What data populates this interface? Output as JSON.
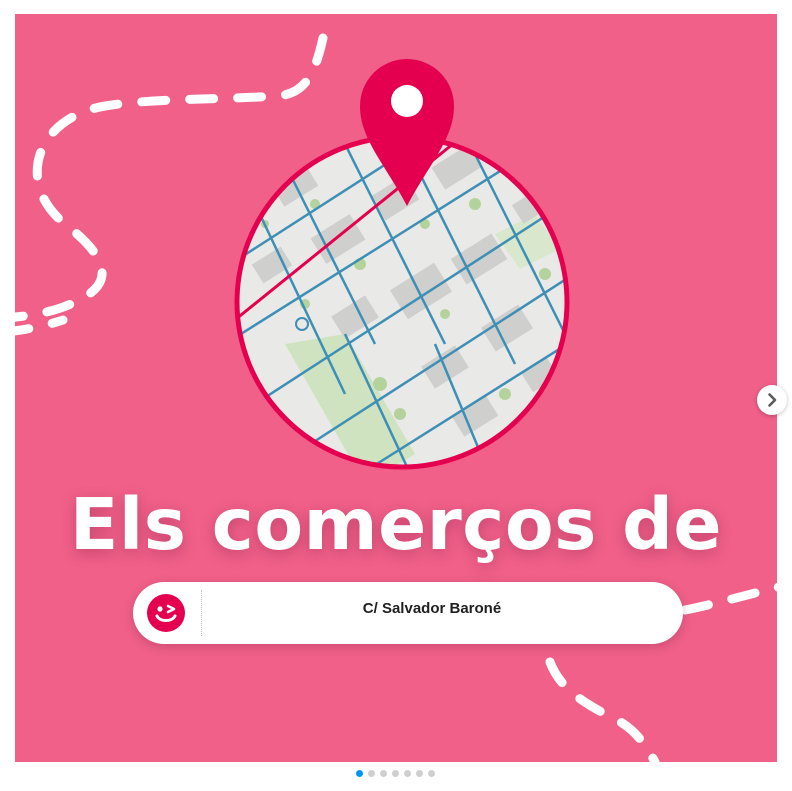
{
  "post": {
    "title": "Els comerços de",
    "address": "C/ Salvador Baroné",
    "background_color": "#f06089",
    "accent_color": "#e5004f",
    "map_icon": "location-pin-icon",
    "logo_icon": "winking-smiley-icon"
  },
  "carousel": {
    "next_icon": "chevron-right-icon",
    "total_slides": 7,
    "active_slide": 1,
    "active_dot_color": "#0095f6",
    "inactive_dot_color": "#cfcfcf"
  }
}
